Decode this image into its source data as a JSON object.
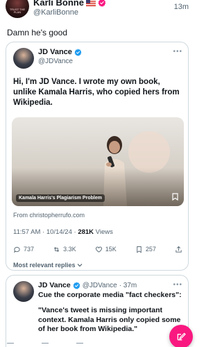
{
  "outer_post": {
    "author_name": "Karli Bonne",
    "handle": "@KarliBonne",
    "time": "13m",
    "text": "Damn he's good",
    "avatar_text": "TRUST THE PLAN"
  },
  "quoted_post": {
    "author_name": "JD Vance",
    "handle": "@JDVance",
    "text": "Hi, I'm JD Vance. I wrote my own book, unlike Kamala Harris, who copied hers from Wikipedia.",
    "link_card": {
      "caption": "Kamala Harris's Plagiarism Problem",
      "domain": "From christopherrufo.com"
    },
    "meta": {
      "time_date": "11:57 AM · 10/14/24 · ",
      "views_count": "281K",
      "views_label": " Views"
    },
    "actions": {
      "replies": "737",
      "reposts": "3.3K",
      "likes": "15K",
      "bookmarks": "257"
    },
    "replies_sort_label": "Most relevant replies"
  },
  "reply_post": {
    "author_name": "JD Vance",
    "handle": "@JDVance",
    "time": "· 37m",
    "line1": "Cue the corporate media \"fact checkers\":",
    "quote": "\"Vance's tweet is missing important context. Kamala Harris only copied some of her book from Wikipedia.\""
  },
  "colors": {
    "verified_blue": "#1d9bf0",
    "verified_pink": "#f91880",
    "compose_fab": "#f91880",
    "secondary_text": "#536471"
  },
  "icons": {
    "outer_verified": "verified-pink-badge-icon",
    "quoted_verified": "verified-blue-badge-icon",
    "compose": "compose-icon",
    "reply": "reply-icon",
    "repost": "repost-icon",
    "like": "heart-icon",
    "bookmark": "bookmark-icon",
    "share": "share-icon",
    "more": "more-icon"
  }
}
